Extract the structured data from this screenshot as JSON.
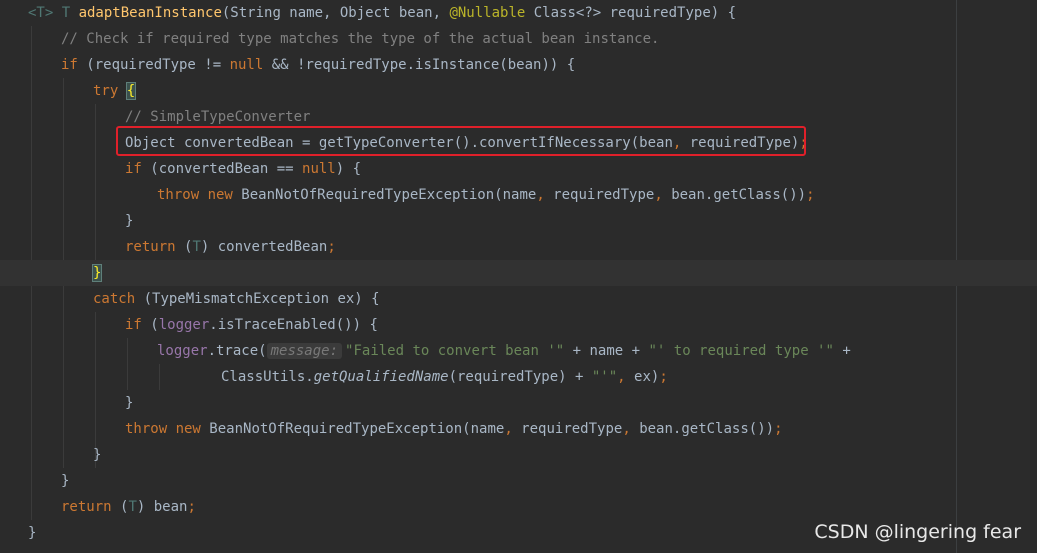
{
  "editor": {
    "lines": [
      [
        [
          "tp",
          "<T> "
        ],
        [
          "tp",
          "T "
        ],
        [
          "fn",
          "adaptBeanInstance"
        ],
        [
          "",
          "(String name, Object bean, "
        ],
        [
          "ann",
          "@Nullable"
        ],
        [
          "",
          " Class<?> requiredType) {"
        ]
      ],
      [
        [
          "cmt",
          "// Check if required type matches the type of the actual bean instance."
        ]
      ],
      [
        [
          "kw",
          "if"
        ],
        [
          "",
          " (requiredType != "
        ],
        [
          "kw",
          "null"
        ],
        [
          "",
          " && !requiredType.isInstance(bean)) {"
        ]
      ],
      [
        [
          "kw",
          "try"
        ],
        [
          "",
          " "
        ],
        [
          "brace",
          "{"
        ]
      ],
      [
        [
          "cmt",
          "// SimpleTypeConverter"
        ]
      ],
      [
        [
          "",
          "Object convertedBean = getTypeConverter().convertIfNecessary(bean"
        ],
        [
          "kw",
          ","
        ],
        [
          "",
          " requiredType)"
        ],
        [
          "kw",
          ";"
        ]
      ],
      [
        [
          "kw",
          "if"
        ],
        [
          "",
          " (convertedBean == "
        ],
        [
          "kw",
          "null"
        ],
        [
          "",
          ") {"
        ]
      ],
      [
        [
          "kw",
          "throw new "
        ],
        [
          "",
          "BeanNotOfRequiredTypeException(name"
        ],
        [
          "kw",
          ","
        ],
        [
          "",
          " requiredType"
        ],
        [
          "kw",
          ","
        ],
        [
          "",
          " bean.getClass())"
        ],
        [
          "kw",
          ";"
        ]
      ],
      [
        [
          "",
          "}"
        ]
      ],
      [
        [
          "kw",
          "return "
        ],
        [
          "",
          "("
        ],
        [
          "tp",
          "T"
        ],
        [
          "",
          ") convertedBean"
        ],
        [
          "kw",
          ";"
        ]
      ],
      [
        [
          "brace",
          "}"
        ]
      ],
      [
        [
          "kw",
          "catch"
        ],
        [
          "",
          " (TypeMismatchException ex) {"
        ]
      ],
      [
        [
          "kw",
          "if"
        ],
        [
          "",
          " ("
        ],
        [
          "fld",
          "logger"
        ],
        [
          "",
          ".isTraceEnabled()) {"
        ]
      ],
      [
        [
          "fld",
          "logger"
        ],
        [
          "",
          ".trace("
        ],
        [
          "hint",
          "message:"
        ],
        [
          "str",
          "\"Failed to convert bean '\""
        ],
        [
          "",
          " + name + "
        ],
        [
          "str",
          "\"' to required type '\""
        ],
        [
          "",
          " +"
        ]
      ],
      [
        [
          "",
          "ClassUtils."
        ],
        [
          "ital",
          "getQualifiedName"
        ],
        [
          "",
          "(requiredType) + "
        ],
        [
          "str",
          "\"'\""
        ],
        [
          "kw",
          ","
        ],
        [
          "",
          " ex)"
        ],
        [
          "kw",
          ";"
        ]
      ],
      [
        [
          "",
          "}"
        ]
      ],
      [
        [
          "kw",
          "throw new "
        ],
        [
          "",
          "BeanNotOfRequiredTypeException(name"
        ],
        [
          "kw",
          ","
        ],
        [
          "",
          " requiredType"
        ],
        [
          "kw",
          ","
        ],
        [
          "",
          " bean.getClass())"
        ],
        [
          "kw",
          ";"
        ]
      ],
      [
        [
          "",
          "}"
        ]
      ],
      [
        [
          "",
          "}"
        ]
      ],
      [
        [
          "kw",
          "return "
        ],
        [
          "",
          "("
        ],
        [
          "tp",
          "T"
        ],
        [
          "",
          ") bean"
        ],
        [
          "kw",
          ";"
        ]
      ],
      [
        [
          "",
          "}"
        ]
      ]
    ]
  },
  "watermark": "CSDN @lingering fear"
}
